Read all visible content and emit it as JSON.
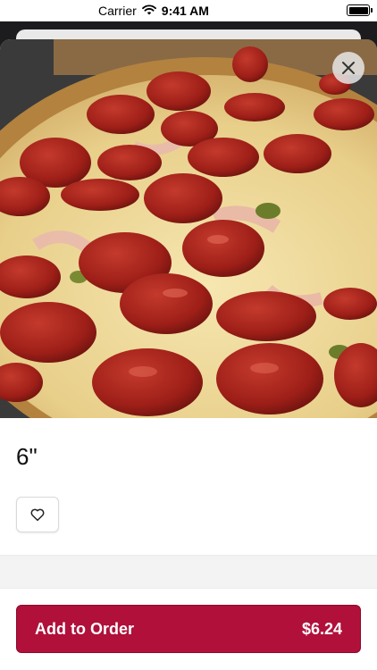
{
  "status_bar": {
    "carrier": "Carrier",
    "time": "9:41 AM",
    "icons": [
      "wifi-icon",
      "battery-icon"
    ]
  },
  "item": {
    "title": "6\"",
    "image": "pepperoni-pizza-photo"
  },
  "actions": {
    "close_icon": "close-icon",
    "favorite_icon": "heart-icon"
  },
  "footer": {
    "add_label": "Add to Order",
    "price": "$6.24"
  },
  "colors": {
    "accent": "#b0103a",
    "background": "#ffffff",
    "band": "#f3f3f4"
  }
}
